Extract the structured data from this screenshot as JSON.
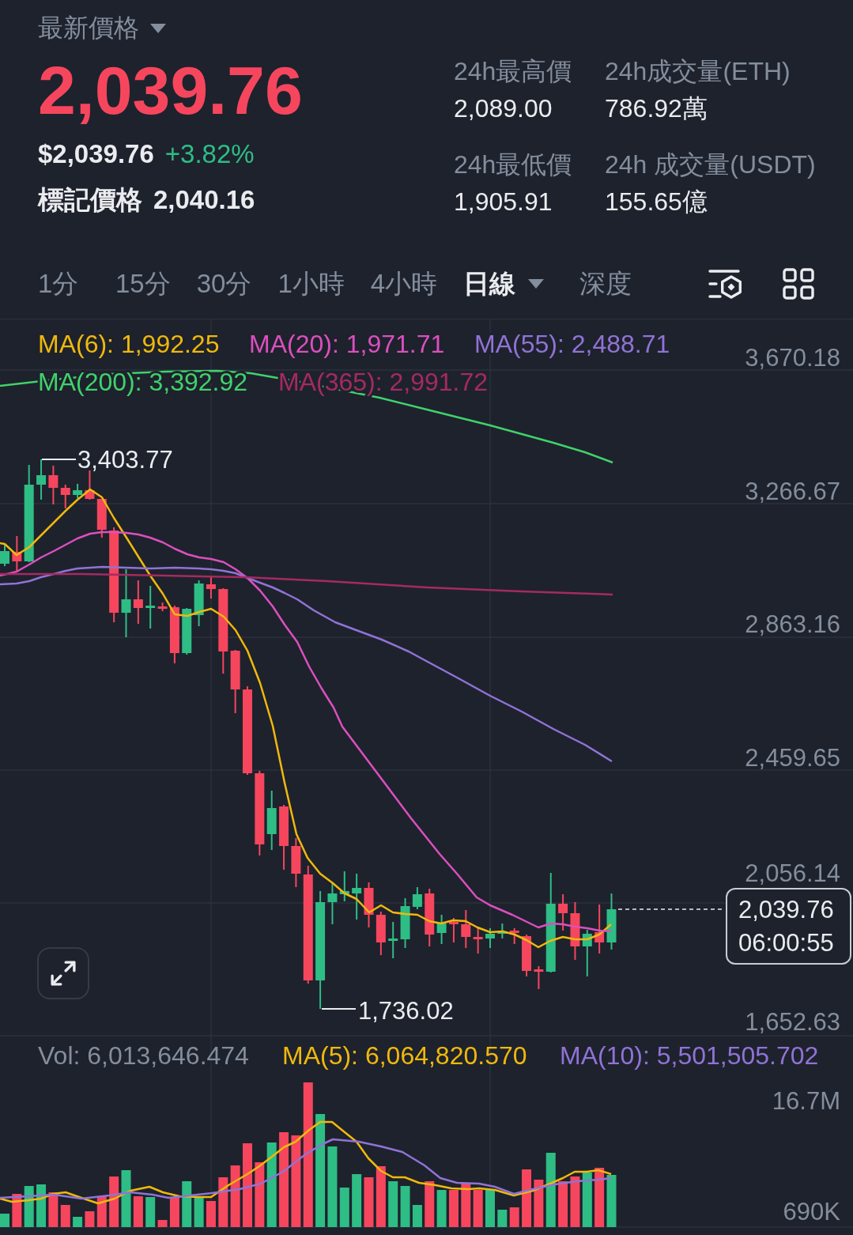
{
  "price_header": {
    "label": "最新價格",
    "price": "2,039.76",
    "usd_price": "$2,039.76",
    "change": "+3.82%",
    "mark_price_label": "標記價格",
    "mark_price": "2,040.16"
  },
  "stats": [
    {
      "label": "24h最高價",
      "value": "2,089.00"
    },
    {
      "label": "24h成交量(ETH)",
      "value": "786.92萬"
    },
    {
      "label": "24h最低價",
      "value": "1,905.91"
    },
    {
      "label": "24h 成交量(USDT)",
      "value": "155.65億"
    }
  ],
  "interval_tabs": [
    {
      "label": "1分",
      "selected": false,
      "kind": "plain"
    },
    {
      "label": "15分",
      "selected": false,
      "kind": "plain"
    },
    {
      "label": "30分",
      "selected": false,
      "kind": "plain"
    },
    {
      "label": "1小時",
      "selected": false,
      "kind": "plain"
    },
    {
      "label": "4小時",
      "selected": false,
      "kind": "plain"
    },
    {
      "label": "日線",
      "selected": true,
      "kind": "dropdown"
    },
    {
      "label": "深度",
      "selected": false,
      "kind": "plain"
    }
  ],
  "price_chart": {
    "legend": [
      {
        "text": "MA(6): 1,992.25",
        "color": "#f0b90b"
      },
      {
        "text": "MA(20): 1,971.71",
        "color": "#dc4fbf"
      },
      {
        "text": "MA(55): 2,488.71",
        "color": "#9073d6"
      },
      {
        "text": "MA(200): 3,392.92",
        "color": "#40d26b"
      },
      {
        "text": "MA(365): 2,991.72",
        "color": "#a52a62"
      }
    ],
    "price_axis": [
      "3,670.18",
      "3,266.67",
      "2,863.16",
      "2,459.65",
      "2,056.14",
      "1,652.63"
    ],
    "high_label": "3,403.77",
    "low_label": "1,736.02",
    "price_tag": {
      "price": "2,039.76",
      "countdown": "06:00:55"
    }
  },
  "volume_chart": {
    "legend": [
      {
        "text": "Vol: 6,013,646.474",
        "color": "#848e9c"
      },
      {
        "text": "MA(5): 6,064,820.570",
        "color": "#f0b90b"
      },
      {
        "text": "MA(10): 5,501,505.702",
        "color": "#9073d6"
      }
    ],
    "volume_axis": [
      "16.7M",
      "690K"
    ]
  }
}
